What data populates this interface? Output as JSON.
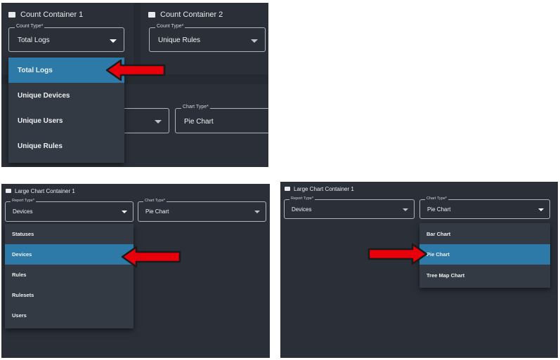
{
  "panel1": {
    "container1_title": "Count Container 1",
    "container2_title": "Count Container 2",
    "count_type_label": "Count Type*",
    "count_type_value_1": "Total Logs",
    "count_type_value_2": "Unique Rules",
    "chart_type_label": "Chart Type*",
    "chart_type_value": "Pie Chart",
    "menu_items": [
      "Total Logs",
      "Unique Devices",
      "Unique Users",
      "Unique Rules"
    ],
    "selected": "Total Logs"
  },
  "panel2": {
    "title": "Large Chart Container 1",
    "report_type_label": "Report Type*",
    "report_type_value": "Devices",
    "chart_type_label": "Chart Type*",
    "chart_type_value": "Pie Chart",
    "menu_items": [
      "Statuses",
      "Devices",
      "Rules",
      "Rulesets",
      "Users"
    ],
    "selected": "Devices"
  },
  "panel3": {
    "title": "Large Chart Container 1",
    "report_type_label": "Report Type*",
    "report_type_value": "Devices",
    "chart_type_label": "Chart Type*",
    "chart_type_value": "Pie Chart",
    "menu_items": [
      "Bar Chart",
      "Pie Chart",
      "Tree Map Chart"
    ],
    "selected": "Pie Chart"
  },
  "colors": {
    "panel_bg": "#2b3038",
    "menu_bg": "#343a43",
    "selected_bg": "#2d7aa8",
    "arrow_fill": "#e8000b",
    "arrow_outline": "#1a1a1a"
  },
  "icons": [
    "card-icon",
    "caret-down-icon",
    "red-arrow-pointer"
  ]
}
